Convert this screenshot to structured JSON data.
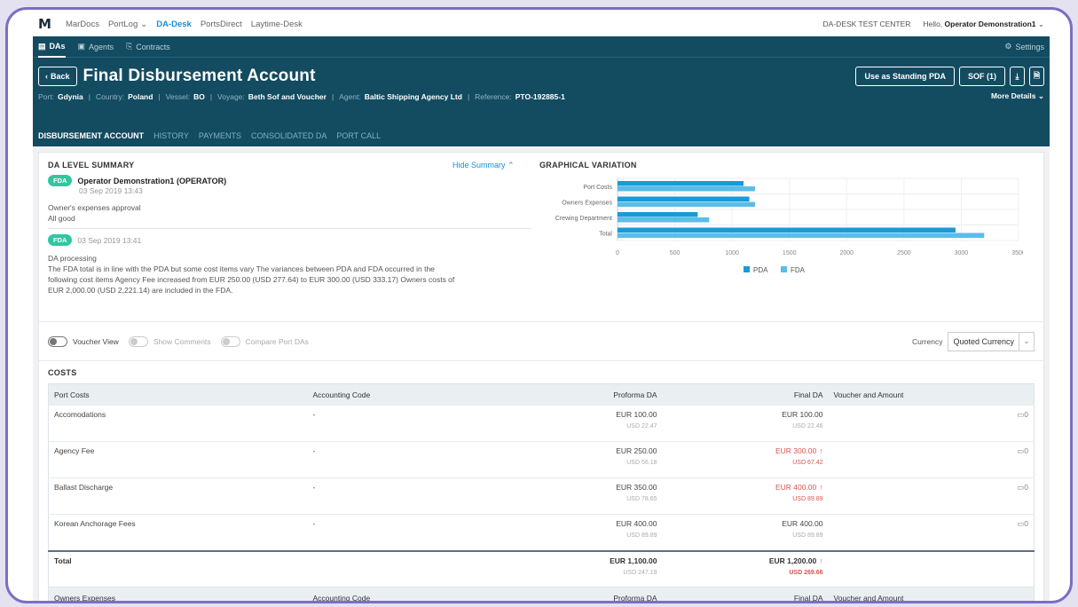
{
  "topnav": {
    "logo": "M",
    "items": [
      {
        "label": "MarDocs",
        "active": false,
        "dropdown": false
      },
      {
        "label": "PortLog",
        "active": false,
        "dropdown": true
      },
      {
        "label": "DA-Desk",
        "active": true,
        "dropdown": false
      },
      {
        "label": "PortsDirect",
        "active": false,
        "dropdown": false
      },
      {
        "label": "Laytime-Desk",
        "active": false,
        "dropdown": false
      }
    ],
    "test_center": "DA-DESK TEST CENTER",
    "hello": "Hello,",
    "user": "Operator Demonstration1"
  },
  "subnav": {
    "items": [
      {
        "label": "DAs",
        "icon": "document-icon",
        "active": true
      },
      {
        "label": "Agents",
        "icon": "agents-icon",
        "active": false
      },
      {
        "label": "Contracts",
        "icon": "contracts-icon",
        "active": false
      }
    ],
    "settings": "Settings"
  },
  "header": {
    "back": "Back",
    "title": "Final Disbursement Account",
    "actions": {
      "standing": "Use as Standing PDA",
      "sof": "SOF (1)"
    },
    "info": {
      "port_label": "Port:",
      "port": "Gdynia",
      "country_label": "Country:",
      "country": "Poland",
      "vessel_label": "Vessel:",
      "vessel": "BO",
      "voyage_label": "Voyage:",
      "voyage": "Beth Sof and Voucher",
      "agent_label": "Agent:",
      "agent": "Baltic Shipping Agency Ltd",
      "reference_label": "Reference:",
      "reference": "PTO-192885-1"
    },
    "more_details": "More Details",
    "tabs": [
      "DISBURSEMENT ACCOUNT",
      "HISTORY",
      "PAYMENTS",
      "CONSOLIDATED DA",
      "PORT CALL"
    ]
  },
  "summary": {
    "title": "DA LEVEL SUMMARY",
    "hide": "Hide Summary",
    "entries": [
      {
        "badge": "FDA",
        "name": "Operator Demonstration1 (OPERATOR)",
        "time": "03 Sep 2019 13:43",
        "lines": [
          "Owner's expenses approval",
          "All good"
        ]
      },
      {
        "badge": "FDA",
        "name": "",
        "time": "03 Sep 2019 13:41",
        "lines": [
          "DA processing",
          "The FDA total is in line with the PDA but some cost items vary The variances between PDA and FDA occurred in the",
          "following cost items Agency Fee increased from EUR 250.00 (USD 277.64) to EUR 300.00 (USD 333.17) Owners costs of",
          "EUR 2,000.00 (USD 2,221.14) are included in the FDA."
        ]
      }
    ]
  },
  "chart_data": {
    "type": "bar",
    "orientation": "horizontal",
    "title": "GRAPHICAL VARIATION",
    "categories": [
      "Port Costs",
      "Owners Expenses",
      "Crewing Department",
      "Total"
    ],
    "series": [
      {
        "name": "PDA",
        "color": "#1a9ad6",
        "values": [
          1100,
          1150,
          700,
          2950
        ]
      },
      {
        "name": "FDA",
        "color": "#5bbde8",
        "values": [
          1200,
          1200,
          800,
          3200
        ]
      }
    ],
    "xlim": [
      0,
      3500
    ],
    "xticks": [
      "0",
      "500",
      "1000",
      "1500",
      "2000",
      "2500",
      "3000",
      "3500"
    ],
    "grid": true,
    "legend": "bottom"
  },
  "toggles": {
    "voucher": "Voucher View",
    "comments": "Show Comments",
    "compare": "Compare Port DAs",
    "currency_label": "Currency",
    "currency_value": "Quoted Currency"
  },
  "costs": {
    "title": "COSTS",
    "headers": [
      "Port Costs",
      "Accounting Code",
      "Proforma DA",
      "Final DA",
      "Voucher and Amount"
    ],
    "rows": [
      {
        "name": "Accomodations",
        "code": "-",
        "pda_eur": "EUR 100.00",
        "pda_usd": "USD 22.47",
        "fda_eur": "EUR 100.00",
        "fda_usd": "USD 22.46",
        "comments": "0"
      },
      {
        "name": "Agency Fee",
        "code": "-",
        "pda_eur": "EUR 250.00",
        "pda_usd": "USD 56.18",
        "fda_eur": "EUR 300.00",
        "fda_usd": "USD 67.42",
        "comments": "0"
      },
      {
        "name": "Ballast Discharge",
        "code": "-",
        "pda_eur": "EUR 350.00",
        "pda_usd": "USD 78.65",
        "fda_eur": "EUR 400.00",
        "fda_usd": "USD 89.89",
        "comments": "0"
      },
      {
        "name": "Korean Anchorage Fees",
        "code": "-",
        "pda_eur": "EUR 400.00",
        "pda_usd": "USD 89.89",
        "fda_eur": "EUR 400.00",
        "fda_usd": "USD 89.89",
        "comments": "0"
      }
    ],
    "total": {
      "label": "Total",
      "pda_eur": "EUR 1,100.00",
      "pda_usd": "USD 247.19",
      "fda_eur": "EUR 1,200.00",
      "fda_usd": "USD 269.66"
    },
    "owners_headers": [
      "Owners Expenses",
      "Accounting Code",
      "Proforma DA",
      "Final DA",
      "Voucher and Amount"
    ]
  }
}
